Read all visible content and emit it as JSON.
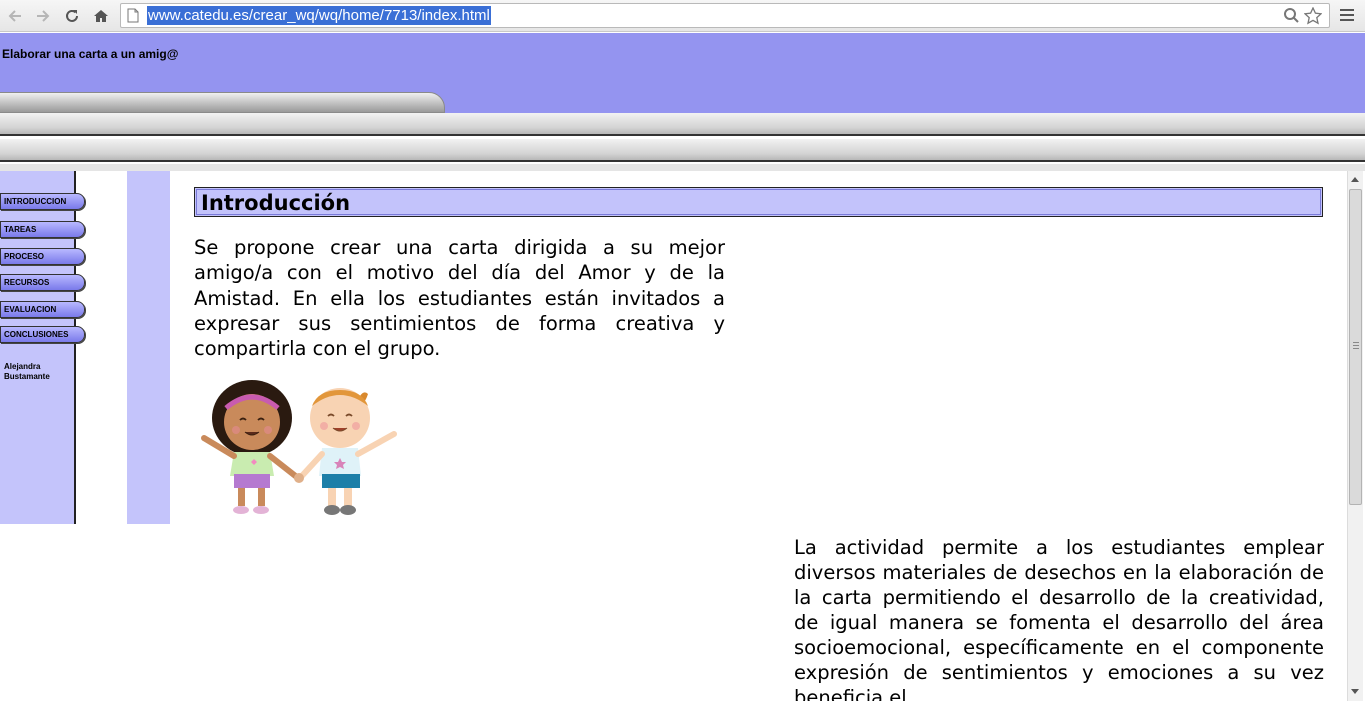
{
  "browser": {
    "url": "www.catedu.es/crear_wq/wq/home/7713/index.html",
    "icons": [
      "back-icon",
      "forward-icon",
      "reload-icon",
      "home-icon",
      "page-icon",
      "zoom-icon",
      "star-icon",
      "menu-icon"
    ]
  },
  "header": {
    "title": "Elaborar una carta a un amig@"
  },
  "sidebar": {
    "items": [
      {
        "label": "INTRODUCCION"
      },
      {
        "label": "TAREAS"
      },
      {
        "label": "PROCESO"
      },
      {
        "label": "RECURSOS"
      },
      {
        "label": "EVALUACION"
      },
      {
        "label": "CONCLUSIONES"
      }
    ],
    "author_first": "Alejandra",
    "author_last": "Bustamante"
  },
  "main": {
    "heading": "Introducción",
    "paragraph1": " Se propone crear una carta dirigida a su mejor amigo/a con el motivo del día del  Amor y de la Amistad.  En ella los estudiantes están invitados a expresar sus sentimientos de forma creativa y compartirla con el grupo.",
    "paragraph2": " La actividad permite a los estudiantes emplear diversos materiales de desechos en la elaboración de la carta permitiendo el desarrollo de la creatividad, de igual manera se fomenta el desarrollo del área socioemocional, específicamente en el componente expresión de sentimientos  y emociones a su vez beneficia  el"
  },
  "colors": {
    "header_bg": "#9494f0",
    "sidebar_bg": "#c4c4fb",
    "heading_bg": "#c3c3fb",
    "url_highlight": "#3a6fd6"
  }
}
